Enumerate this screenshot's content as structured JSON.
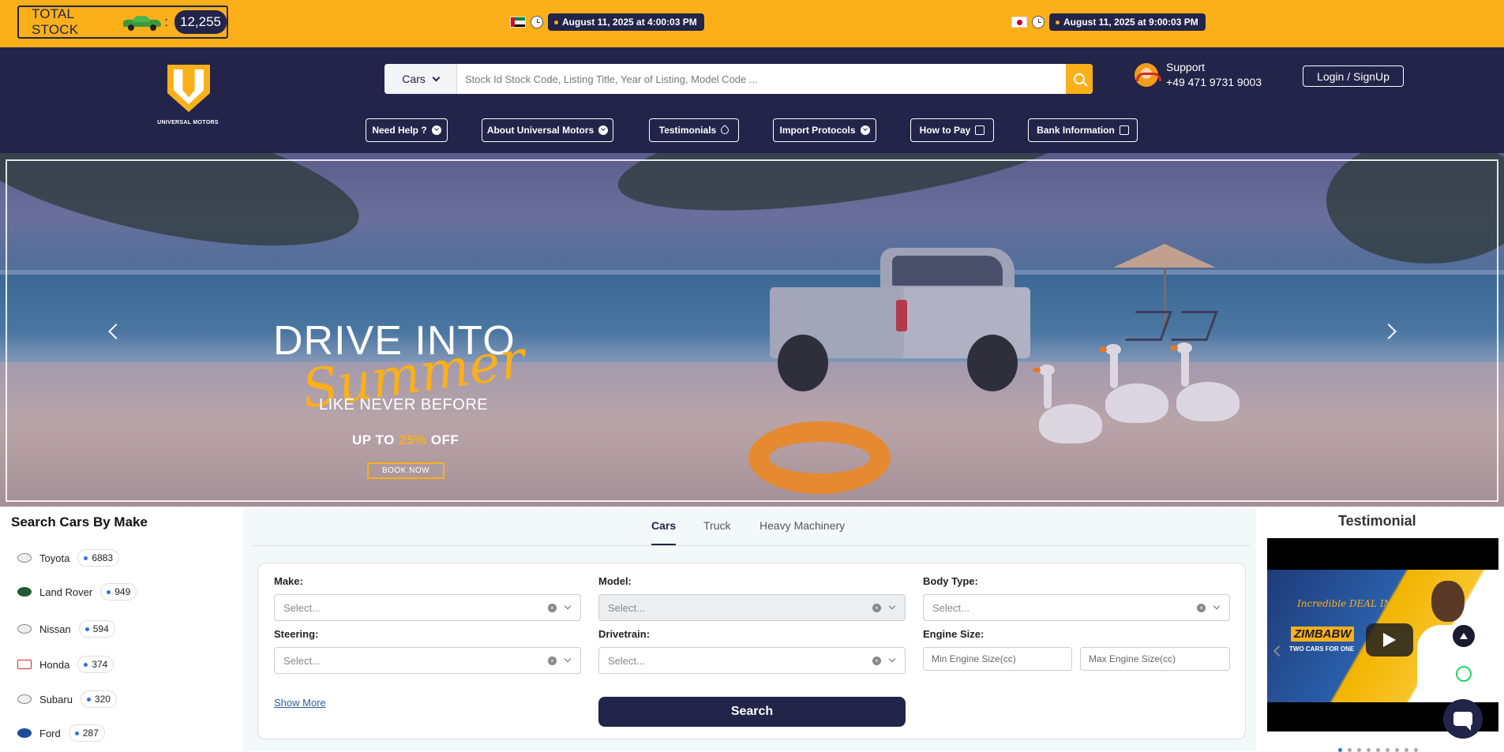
{
  "topbar": {
    "stock_label": "TOTAL STOCK",
    "stock_colon": ":",
    "stock_count": "12,255",
    "clock_uae": "August 11, 2025 at 4:00:03 PM",
    "clock_japan": "August 11, 2025 at 9:00:03 PM"
  },
  "header": {
    "logo_text": "UNIVERSAL MOTORS",
    "search_category": "Cars",
    "search_placeholder": "Stock Id Stock Code, Listing Title, Year of Listing, Model Code ...",
    "support_label": "Support",
    "support_phone": "+49 471 9731 9003",
    "login_label": "Login / SignUp",
    "nav": [
      {
        "label": "Need Help ?"
      },
      {
        "label": "About Universal Motors"
      },
      {
        "label": "Testimonials"
      },
      {
        "label": "Import Protocols"
      },
      {
        "label": "How to Pay"
      },
      {
        "label": "Bank Information"
      }
    ]
  },
  "hero": {
    "line1": "DRIVE INTO",
    "line2": "Summer",
    "line3": "LIKE NEVER BEFORE",
    "offer_prefix": "UP TO",
    "offer_pct": "25%",
    "offer_suffix": "OFF",
    "cta": "BOOK NOW"
  },
  "sidebar": {
    "title": "Search Cars By Make",
    "makes": [
      {
        "name": "Toyota",
        "count": "6883"
      },
      {
        "name": "Land Rover",
        "count": "949"
      },
      {
        "name": "Nissan",
        "count": "594"
      },
      {
        "name": "Honda",
        "count": "374"
      },
      {
        "name": "Subaru",
        "count": "320"
      },
      {
        "name": "Ford",
        "count": "287"
      }
    ]
  },
  "search_panel": {
    "tabs": [
      "Cars",
      "Truck",
      "Heavy Machinery"
    ],
    "make_label": "Make:",
    "model_label": "Model:",
    "body_label": "Body Type:",
    "steering_label": "Steering:",
    "drivetrain_label": "Drivetrain:",
    "engine_label": "Engine Size:",
    "select_placeholder": "Select...",
    "min_engine": "Min Engine Size(cc)",
    "max_engine": "Max Engine Size(cc)",
    "show_more": "Show More",
    "search_button": "Search"
  },
  "testimonial": {
    "title": "Testimonial",
    "thumb_line1": "Incredible DEAL IN",
    "thumb_line2": "ZIMBABW",
    "thumb_line3": "TWO CARS FOR ONE"
  },
  "colors": {
    "accent": "#fbb01a",
    "navy": "#23244a"
  }
}
